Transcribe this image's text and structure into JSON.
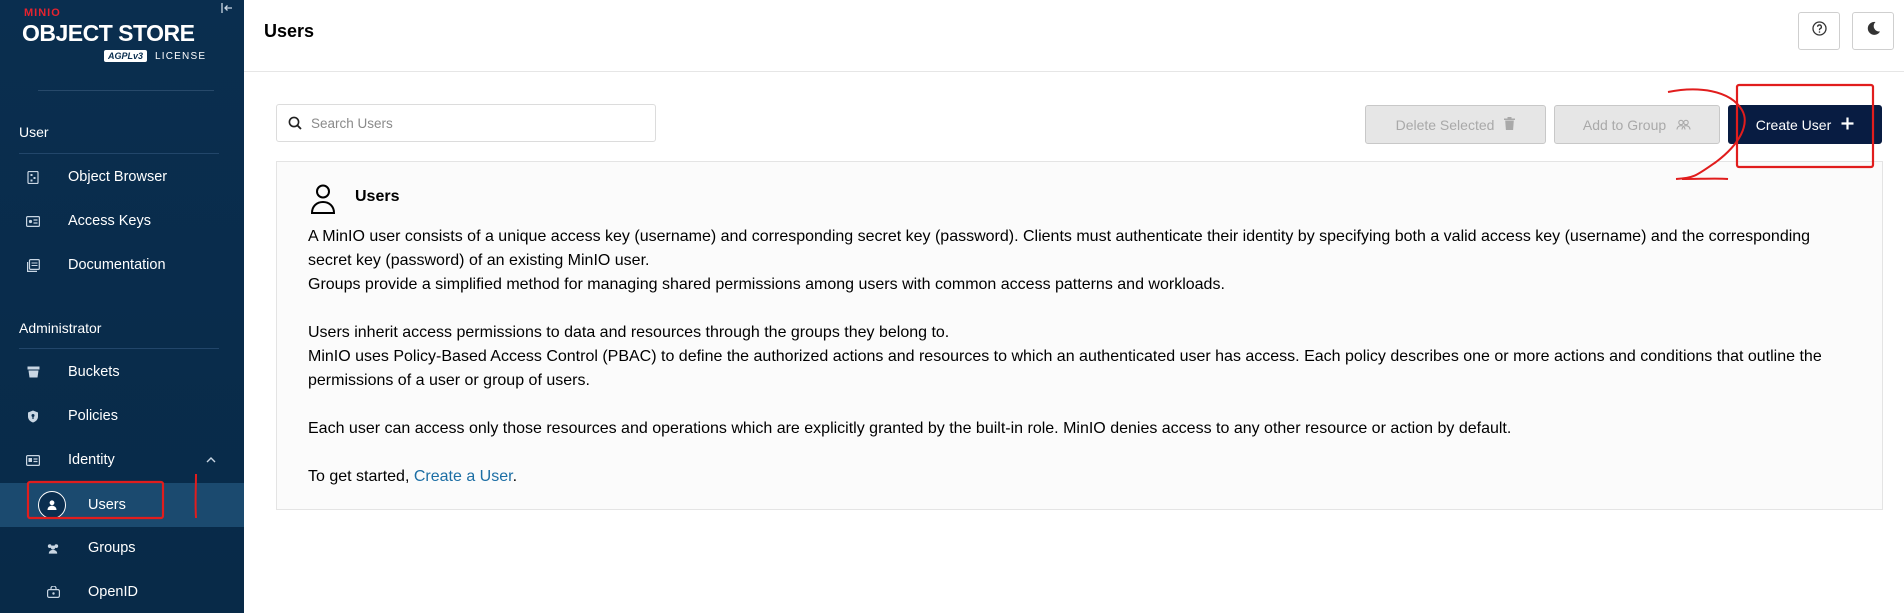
{
  "brand": {
    "small": "MINIO",
    "title": "OBJECT STORE",
    "license_badge": "AGPLv3",
    "license_label": "LICENSE"
  },
  "sidebar": {
    "sections": [
      {
        "title": "User"
      },
      {
        "title": "Administrator"
      }
    ],
    "user_items": [
      {
        "label": "Object Browser",
        "icon": "object-browser-icon"
      },
      {
        "label": "Access Keys",
        "icon": "access-keys-icon"
      },
      {
        "label": "Documentation",
        "icon": "documentation-icon"
      }
    ],
    "admin_items": [
      {
        "label": "Buckets",
        "icon": "bucket-icon"
      },
      {
        "label": "Policies",
        "icon": "policy-icon"
      },
      {
        "label": "Identity",
        "icon": "identity-icon"
      }
    ],
    "identity_items": [
      {
        "label": "Users",
        "icon": "user-icon",
        "active": true
      },
      {
        "label": "Groups",
        "icon": "groups-icon"
      },
      {
        "label": "OpenID",
        "icon": "openid-icon"
      }
    ]
  },
  "header": {
    "title": "Users"
  },
  "toolbar": {
    "search_placeholder": "Search Users",
    "delete_label": "Delete Selected",
    "add_group_label": "Add to Group",
    "create_label": "Create User"
  },
  "help": {
    "title": "Users",
    "p1a": "A MinIO user consists of a unique access key (username) and corresponding secret key (password). Clients must authenticate their identity by specifying both a valid access key (username) and the corresponding secret key (password) of an existing MinIO user.",
    "p1b": "Groups provide a simplified method for managing shared permissions among users with common access patterns and workloads.",
    "p2a": "Users inherit access permissions to data and resources through the groups they belong to.",
    "p2b": "MinIO uses Policy-Based Access Control (PBAC) to define the authorized actions and resources to which an authenticated user has access. Each policy describes one or more actions and conditions that outline the permissions of a user or group of users.",
    "p3": "Each user can access only those resources and operations which are explicitly granted by the built-in role. MinIO denies access to any other resource or action by default.",
    "p4_prefix": "To get started, ",
    "p4_link": "Create a User",
    "p4_suffix": "."
  },
  "colors": {
    "sidebar_bg": "#0a2e4f",
    "active_item_bg": "#1b4a6f",
    "primary_button": "#081c42",
    "link": "#1c6ea4",
    "annotation": "#e11d1d"
  }
}
